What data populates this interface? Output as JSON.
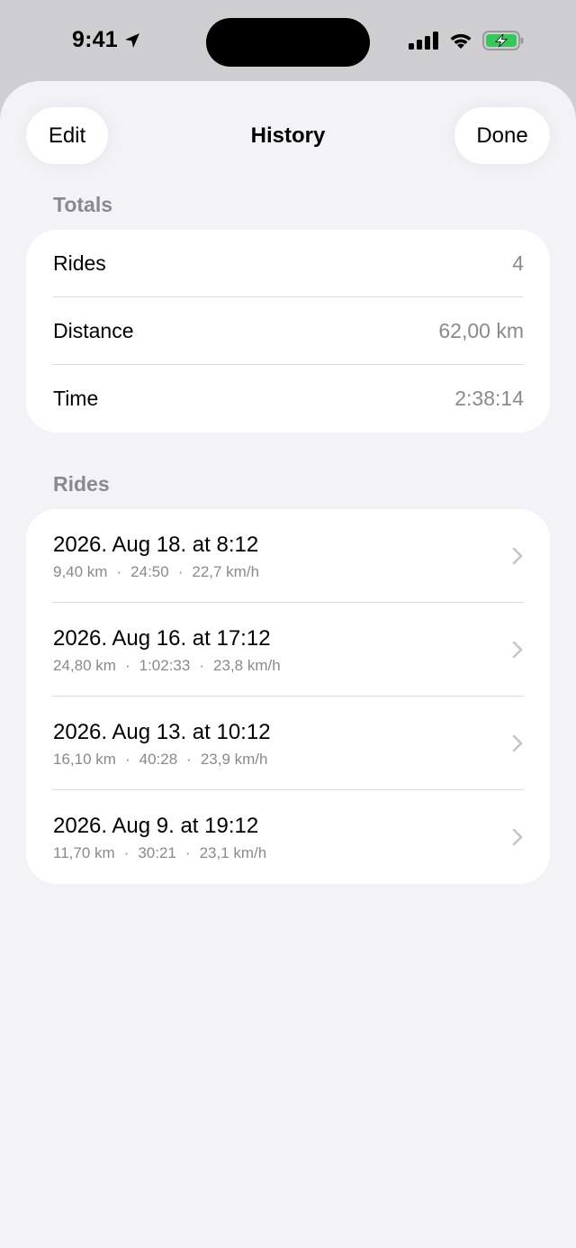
{
  "status": {
    "time": "9:41"
  },
  "nav": {
    "edit_label": "Edit",
    "title": "History",
    "done_label": "Done"
  },
  "totals": {
    "header": "Totals",
    "rows": [
      {
        "label": "Rides",
        "value": "4"
      },
      {
        "label": "Distance",
        "value": "62,00 km"
      },
      {
        "label": "Time",
        "value": "2:38:14"
      }
    ]
  },
  "rides": {
    "header": "Rides",
    "items": [
      {
        "title": "2026. Aug 18. at 8:12",
        "distance": "9,40 km",
        "duration": "24:50",
        "speed": "22,7 km/h"
      },
      {
        "title": "2026. Aug 16. at 17:12",
        "distance": "24,80 km",
        "duration": "1:02:33",
        "speed": "23,8 km/h"
      },
      {
        "title": "2026. Aug 13. at 10:12",
        "distance": "16,10 km",
        "duration": "40:28",
        "speed": "23,9 km/h"
      },
      {
        "title": "2026. Aug 9. at 19:12",
        "distance": "11,70 km",
        "duration": "30:21",
        "speed": "23,1 km/h"
      }
    ],
    "separator": "·"
  },
  "colors": {
    "battery_fill": "#34c759",
    "secondary_text": "#8a8a8e",
    "background": "#f2f2f7"
  },
  "icons": [
    "location-arrow-icon",
    "signal-icon",
    "wifi-icon",
    "battery-charging-icon",
    "chevron-right-icon"
  ]
}
